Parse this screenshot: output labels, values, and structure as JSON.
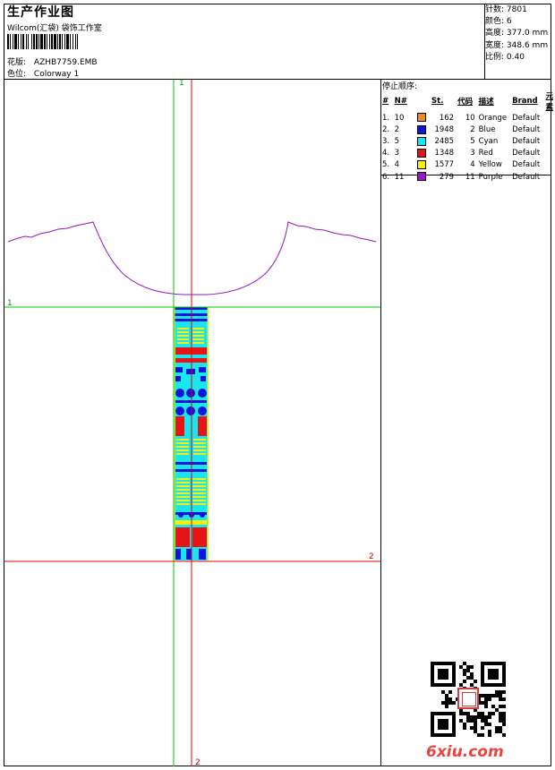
{
  "header": {
    "title": "生产作业图",
    "studio": "Wilcom(汇袋) 袋饰工作室",
    "design_label": "花版:",
    "design_value": "AZHB7759.EMB",
    "colorway_label": "色位:",
    "colorway_value": "Colorway 1"
  },
  "stats": [
    {
      "label": "针数:",
      "value": "7801"
    },
    {
      "label": "颜色:",
      "value": "6"
    },
    {
      "label": "高度:",
      "value": "377.0 mm"
    },
    {
      "label": "宽度:",
      "value": "348.6 mm"
    },
    {
      "label": "比例:",
      "value": "0.40"
    }
  ],
  "stop_sequence": {
    "title": "停止顺序:",
    "headers": [
      "#",
      "N#",
      "St.",
      "代码",
      "描述",
      "Brand",
      "元素"
    ],
    "rows": [
      {
        "idx": "1.",
        "n": "10",
        "color": "#f08a24",
        "st": "162",
        "code": "10",
        "desc": "Orange",
        "brand": "Default"
      },
      {
        "idx": "2.",
        "n": "2",
        "color": "#0a14dc",
        "st": "1948",
        "code": "2",
        "desc": "Blue",
        "brand": "Default"
      },
      {
        "idx": "3.",
        "n": "5",
        "color": "#19e6f0",
        "st": "2485",
        "code": "5",
        "desc": "Cyan",
        "brand": "Default"
      },
      {
        "idx": "4.",
        "n": "3",
        "color": "#e61414",
        "st": "1348",
        "code": "3",
        "desc": "Red",
        "brand": "Default"
      },
      {
        "idx": "5.",
        "n": "4",
        "color": "#f5f00a",
        "st": "1577",
        "code": "4",
        "desc": "Yellow",
        "brand": "Default"
      },
      {
        "idx": "6.",
        "n": "11",
        "color": "#9b14c8",
        "st": "279",
        "code": "11",
        "desc": "Purple",
        "brand": "Default"
      }
    ]
  },
  "axes": {
    "v1_top": "1",
    "v2_bottom": "2",
    "h1_left": "1",
    "h2_right": "2"
  },
  "guide_colors": {
    "green": "#00c800",
    "red": "#e60000",
    "outline": "#9b14c8"
  },
  "watermark": "6xiu.com"
}
